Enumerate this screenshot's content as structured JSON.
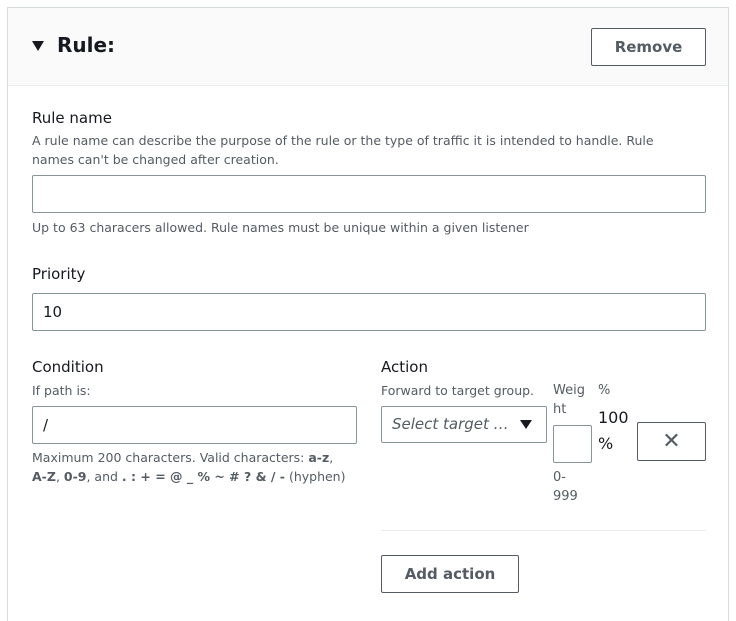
{
  "header": {
    "title": "Rule:",
    "remove_label": "Remove"
  },
  "rule_name": {
    "label": "Rule name",
    "description": "A rule name can describe the purpose of the rule or the type of traffic it is intended to handle. Rule names can't be changed after creation.",
    "value": "",
    "placeholder": "",
    "hint": "Up to 63 characers allowed. Rule names must be unique within a given listener"
  },
  "priority": {
    "label": "Priority",
    "value": "10"
  },
  "condition": {
    "label": "Condition",
    "description": "If path is:",
    "value": "/",
    "hint_prefix": "Maximum 200 characters. Valid characters: ",
    "hint_kw1": "a-z",
    "hint_sep1": ", ",
    "hint_kw2": "A-Z",
    "hint_sep2": ", ",
    "hint_kw3": "0-9",
    "hint_sep3": ", and ",
    "hint_kw4": ". : + = @ _ % ~ # ? & / -",
    "hint_suffix": " (hyphen)"
  },
  "action": {
    "label": "Action",
    "description": "Forward to target group.",
    "select_placeholder": "Select target …",
    "weight_label_line1": "Weig",
    "weight_label_line2": "ht",
    "weight_value": "",
    "weight_range_line1": "0-",
    "weight_range_line2": "999",
    "percent_header": "%",
    "percent_value": "100",
    "percent_unit": "%",
    "remove_symbol": "✕",
    "add_action_label": "Add action"
  }
}
